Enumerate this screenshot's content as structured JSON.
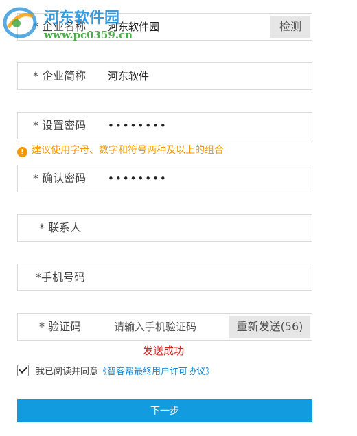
{
  "form": {
    "company_name": {
      "label": "* 企业名称",
      "value": "河东软件园",
      "check_label": "检测"
    },
    "company_short": {
      "label": "* 企业简称",
      "value": "河东软件"
    },
    "set_password": {
      "label": "* 设置密码",
      "value": "••••••••"
    },
    "password_hint": "建议使用字母、数字和符号两种及以上的组合",
    "confirm_password": {
      "label": "* 确认密码",
      "value": "••••••••"
    },
    "contact": {
      "label": "* 联系人",
      "value": ""
    },
    "phone": {
      "label": "*手机号码",
      "value": ""
    },
    "verify_code": {
      "label": "* 验证码",
      "placeholder": "请输入手机验证码",
      "resend_label": "重新发送(56)"
    },
    "send_status": "发送成功",
    "agree": {
      "text": "我已阅读并同意",
      "link": "《智客帮最终用户许可协议》",
      "checked": true
    },
    "next_label": "下一步"
  },
  "watermark": {
    "title": "河东软件园",
    "url": "www.pc0359.cn"
  },
  "colors": {
    "primary_button": "#139be0",
    "hint": "#f39800",
    "success": "#d4281f",
    "link": "#1a8ad6"
  }
}
